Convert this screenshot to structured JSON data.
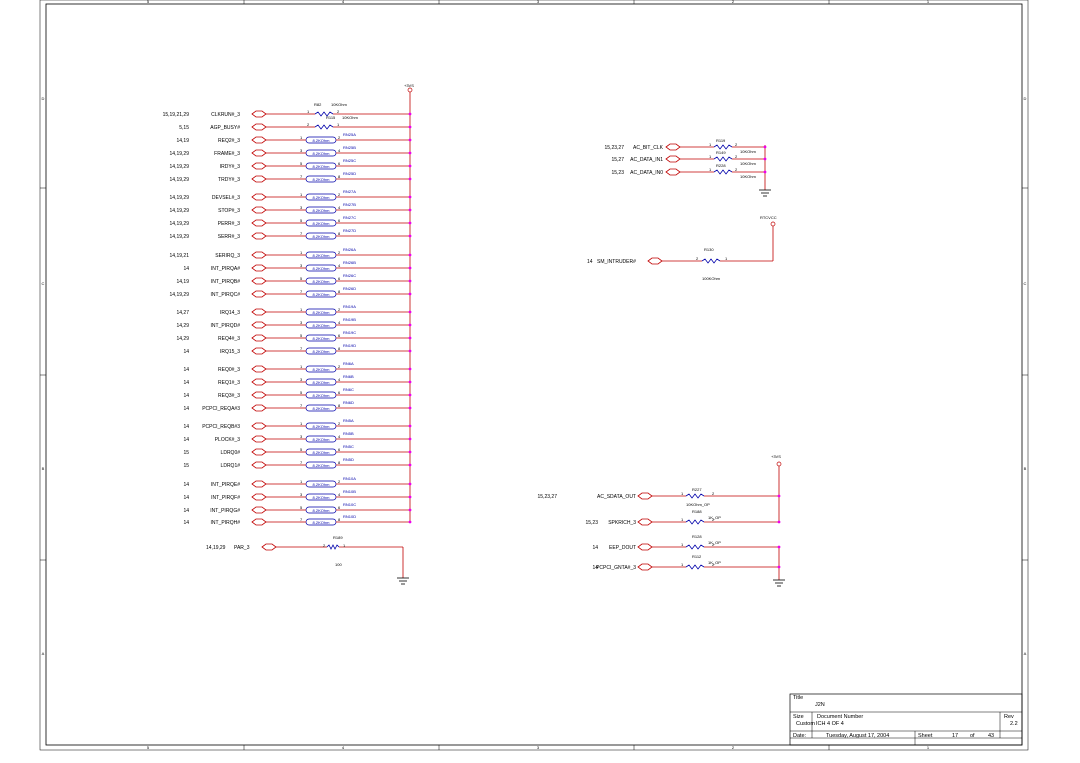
{
  "sheet": {
    "zone_numbers": [
      "5",
      "4",
      "3",
      "2",
      "1"
    ],
    "zone_letters": [
      "D",
      "C",
      "B",
      "A"
    ]
  },
  "power": {
    "vcc_left": "+3VS",
    "rtcvcc": "RTCVCC",
    "vcc_right": "+3VS"
  },
  "left_signals": [
    {
      "refs": "15,19,21,29",
      "name": "CLKRUN#_3",
      "part": "R82",
      "value": "10KOhm",
      "pin_a": "1",
      "pin_b": "2"
    },
    {
      "refs": "5,15",
      "name": "AGP_BUSY#",
      "part": "R115",
      "value": "10KOhm",
      "pin_a": "2",
      "pin_b": "1"
    },
    {
      "refs": "14,19",
      "name": "REQ2#_3",
      "part": "RN25A",
      "value": "8.2KOhm",
      "pin_a": "1",
      "pin_b": "2"
    },
    {
      "refs": "14,19,29",
      "name": "FRAME#_3",
      "part": "RN25B",
      "value": "8.2KOhm",
      "pin_a": "3",
      "pin_b": "4"
    },
    {
      "refs": "14,19,29",
      "name": "IRDY#_3",
      "part": "RN25C",
      "value": "8.2KOhm",
      "pin_a": "5",
      "pin_b": "6"
    },
    {
      "refs": "14,19,29",
      "name": "TRDY#_3",
      "part": "RN25D",
      "value": "8.2KOhm",
      "pin_a": "7",
      "pin_b": "8"
    },
    {
      "refs": "14,19,29",
      "name": "DEVSEL#_3",
      "part": "RN27A",
      "value": "8.2KOhm",
      "pin_a": "1",
      "pin_b": "2"
    },
    {
      "refs": "14,19,29",
      "name": "STOP#_3",
      "part": "RN27B",
      "value": "8.2KOhm",
      "pin_a": "3",
      "pin_b": "4"
    },
    {
      "refs": "14,19,29",
      "name": "PERR#_3",
      "part": "RN27C",
      "value": "8.2KOhm",
      "pin_a": "5",
      "pin_b": "6"
    },
    {
      "refs": "14,19,29",
      "name": "SERR#_3",
      "part": "RN27D",
      "value": "8.2KOhm",
      "pin_a": "7",
      "pin_b": "8"
    },
    {
      "refs": "14,19,21",
      "name": "SERIRQ_3",
      "part": "RN26A",
      "value": "8.2KOhm",
      "pin_a": "1",
      "pin_b": "2"
    },
    {
      "refs": "14",
      "name": "INT_PIRQA#",
      "part": "RN26B",
      "value": "8.2KOhm",
      "pin_a": "3",
      "pin_b": "4"
    },
    {
      "refs": "14,19",
      "name": "INT_PIRQB#",
      "part": "RN26C",
      "value": "8.2KOhm",
      "pin_a": "5",
      "pin_b": "6"
    },
    {
      "refs": "14,19,29",
      "name": "INT_PIRQC#",
      "part": "RN26D",
      "value": "8.2KOhm",
      "pin_a": "7",
      "pin_b": "8"
    },
    {
      "refs": "14,27",
      "name": "IRQ14_3",
      "part": "RN19A",
      "value": "8.2KOhm",
      "pin_a": "1",
      "pin_b": "2"
    },
    {
      "refs": "14,29",
      "name": "INT_PIRQD#",
      "part": "RN19B",
      "value": "8.2KOhm",
      "pin_a": "3",
      "pin_b": "4"
    },
    {
      "refs": "14,29",
      "name": "REQ4#_3",
      "part": "RN19C",
      "value": "8.2KOhm",
      "pin_a": "5",
      "pin_b": "6"
    },
    {
      "refs": "14",
      "name": "IRQ15_3",
      "part": "RN19D",
      "value": "8.2KOhm",
      "pin_a": "7",
      "pin_b": "8"
    },
    {
      "refs": "14",
      "name": "REQ0#_3",
      "part": "RN6A",
      "value": "8.2KOhm",
      "pin_a": "1",
      "pin_b": "2"
    },
    {
      "refs": "14",
      "name": "REQ1#_3",
      "part": "RN6B",
      "value": "8.2KOhm",
      "pin_a": "3",
      "pin_b": "4"
    },
    {
      "refs": "14",
      "name": "REQ3#_3",
      "part": "RN6C",
      "value": "8.2KOhm",
      "pin_a": "5",
      "pin_b": "6"
    },
    {
      "refs": "14",
      "name": "PCPCI_REQA#3",
      "part": "RN6D",
      "value": "8.2KOhm",
      "pin_a": "7",
      "pin_b": "8"
    },
    {
      "refs": "14",
      "name": "PCPCI_REQB#3",
      "part": "RN5A",
      "value": "8.2KOhm",
      "pin_a": "1",
      "pin_b": "2"
    },
    {
      "refs": "14",
      "name": "PLOCK#_3",
      "part": "RN5B",
      "value": "8.2KOhm",
      "pin_a": "3",
      "pin_b": "4"
    },
    {
      "refs": "15",
      "name": "LDRQ0#",
      "part": "RN5C",
      "value": "8.2KOhm",
      "pin_a": "5",
      "pin_b": "6"
    },
    {
      "refs": "15",
      "name": "LDRQ1#",
      "part": "RN5D",
      "value": "8.2KOhm",
      "pin_a": "7",
      "pin_b": "8"
    },
    {
      "refs": "14",
      "name": "INT_PIRQE#",
      "part": "RN10A",
      "value": "8.2KOhm",
      "pin_a": "1",
      "pin_b": "2"
    },
    {
      "refs": "14",
      "name": "INT_PIRQF#",
      "part": "RN10B",
      "value": "8.2KOhm",
      "pin_a": "3",
      "pin_b": "4"
    },
    {
      "refs": "14",
      "name": "INT_PIRQG#",
      "part": "RN10C",
      "value": "8.2KOhm",
      "pin_a": "5",
      "pin_b": "6"
    },
    {
      "refs": "14",
      "name": "INT_PIRQH#",
      "part": "RN10D",
      "value": "8.2KOhm",
      "pin_a": "7",
      "pin_b": "8"
    }
  ],
  "par": {
    "refs": "14,19,29",
    "name": "PAR_3",
    "part": "R189",
    "value": "100",
    "pin_a": "2",
    "pin_b": "1"
  },
  "ac_signals": [
    {
      "refs": "15,23,27",
      "name": "AC_BIT_CLK",
      "part": "R119",
      "value": "10KOhm",
      "pin_a": "1",
      "pin_b": "2"
    },
    {
      "refs": "15,27",
      "name": "AC_DATA_IN1",
      "part": "R149",
      "value": "10KOhm",
      "pin_a": "1",
      "pin_b": "2"
    },
    {
      "refs": "15,23",
      "name": "AC_DATA_IN0",
      "part": "R228",
      "value": "10KOhm",
      "pin_a": "1",
      "pin_b": "2"
    }
  ],
  "intruder": {
    "refs": "14",
    "name": "SM_INTRUDER#",
    "part": "R130",
    "value": "100KOhm",
    "pin_a": "2",
    "pin_b": "1"
  },
  "bottom_right": [
    {
      "refs": "15,23,27",
      "name": "AC_SDATA_OUT",
      "part": "R227",
      "value": "10KOhm_OP",
      "pin_a": "1",
      "pin_b": "2"
    },
    {
      "refs": "15,23",
      "name": "SPKRICH_3",
      "part": "R188",
      "value": "1K_OP",
      "pin_a": "1",
      "pin_b": "2"
    },
    {
      "refs": "14",
      "name": "EEP_DOUT",
      "part": "R128",
      "value": "1K_OP",
      "pin_a": "1",
      "pin_b": "2"
    },
    {
      "refs": "14",
      "name": "PCPCI_GNTA#_3",
      "part": "R112",
      "value": "1K_OP",
      "pin_a": "1",
      "pin_b": "2"
    }
  ],
  "title_block": {
    "title_label": "Title",
    "title": "J2N",
    "size_label": "Size",
    "size": "Custom",
    "doc_label": "Document Number",
    "doc": "ICH 4 OF 4",
    "rev_label": "Rev",
    "rev": "2.2",
    "date_label": "Date:",
    "date": "Tuesday, August 17, 2004",
    "sheet_label": "Sheet",
    "sheet": "17",
    "of_label": "of",
    "total": "43"
  }
}
